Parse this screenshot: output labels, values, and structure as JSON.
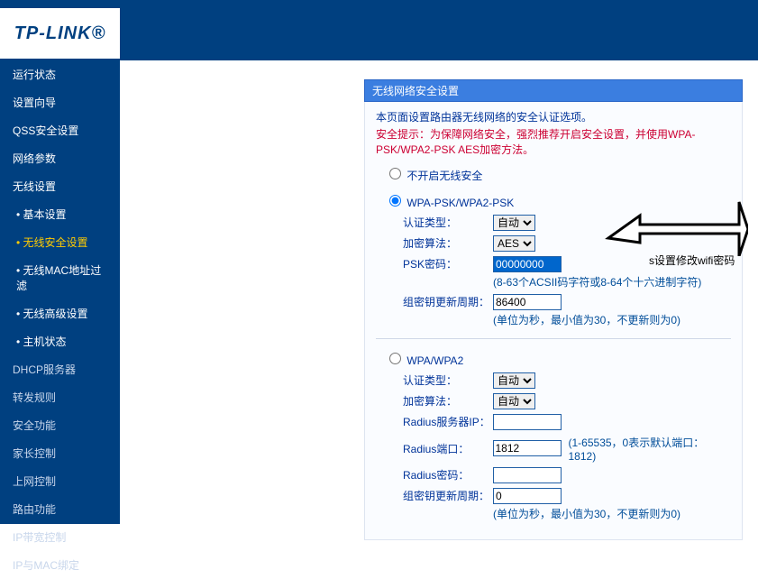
{
  "brand": "TP-LINK®",
  "sidebar": [
    {
      "label": "运行状态",
      "sub": false,
      "hl": false,
      "gray": false
    },
    {
      "label": "设置向导",
      "sub": false,
      "hl": false,
      "gray": false
    },
    {
      "label": "QSS安全设置",
      "sub": false,
      "hl": false,
      "gray": false
    },
    {
      "label": "网络参数",
      "sub": false,
      "hl": false,
      "gray": false
    },
    {
      "label": "无线设置",
      "sub": false,
      "hl": false,
      "gray": false
    },
    {
      "label": "基本设置",
      "sub": true,
      "hl": false,
      "gray": false
    },
    {
      "label": "无线安全设置",
      "sub": true,
      "hl": true,
      "gray": false
    },
    {
      "label": "无线MAC地址过滤",
      "sub": true,
      "hl": false,
      "gray": false
    },
    {
      "label": "无线高级设置",
      "sub": true,
      "hl": false,
      "gray": false
    },
    {
      "label": "主机状态",
      "sub": true,
      "hl": false,
      "gray": false
    },
    {
      "label": "DHCP服务器",
      "sub": false,
      "hl": false,
      "gray": true
    },
    {
      "label": "转发规则",
      "sub": false,
      "hl": false,
      "gray": true
    },
    {
      "label": "安全功能",
      "sub": false,
      "hl": false,
      "gray": true
    },
    {
      "label": "家长控制",
      "sub": false,
      "hl": false,
      "gray": true
    },
    {
      "label": "上网控制",
      "sub": false,
      "hl": false,
      "gray": true
    },
    {
      "label": "路由功能",
      "sub": false,
      "hl": false,
      "gray": true
    },
    {
      "label": "IP带宽控制",
      "sub": false,
      "hl": false,
      "gray": true
    },
    {
      "label": "IP与MAC绑定",
      "sub": false,
      "hl": false,
      "gray": true
    }
  ],
  "panel": {
    "title": "无线网络安全设置",
    "intro": "本页面设置路由器无线网络的安全认证选项。",
    "warn": "安全提示：为保障网络安全，强烈推荐开启安全设置，并使用WPA-PSK/WPA2-PSK AES加密方法。",
    "radio_off": "不开启无线安全",
    "radio_wpapsk": "WPA-PSK/WPA2-PSK",
    "radio_wpa": "WPA/WPA2",
    "auth_label": "认证类型：",
    "enc_label": "加密算法：",
    "psk_label": "PSK密码：",
    "group_label": "组密钥更新周期：",
    "radius_ip_label": "Radius服务器IP：",
    "radius_port_label": "Radius端口：",
    "radius_pw_label": "Radius密码：",
    "auto_option": "自动",
    "aes_option": "AES",
    "psk_value": "00000000",
    "psk_hint": "(8-63个ACSII码字符或8-64个十六进制字符)",
    "group_value": "86400",
    "group_hint": "(单位为秒，最小值为30，不更新则为0)",
    "radius_ip_value": "",
    "radius_port_value": "1812",
    "radius_port_hint": "(1-65535，0表示默认端口：1812)",
    "radius_pw_value": "",
    "group2_value": "0"
  },
  "callout": "s设置修改wifi密码"
}
